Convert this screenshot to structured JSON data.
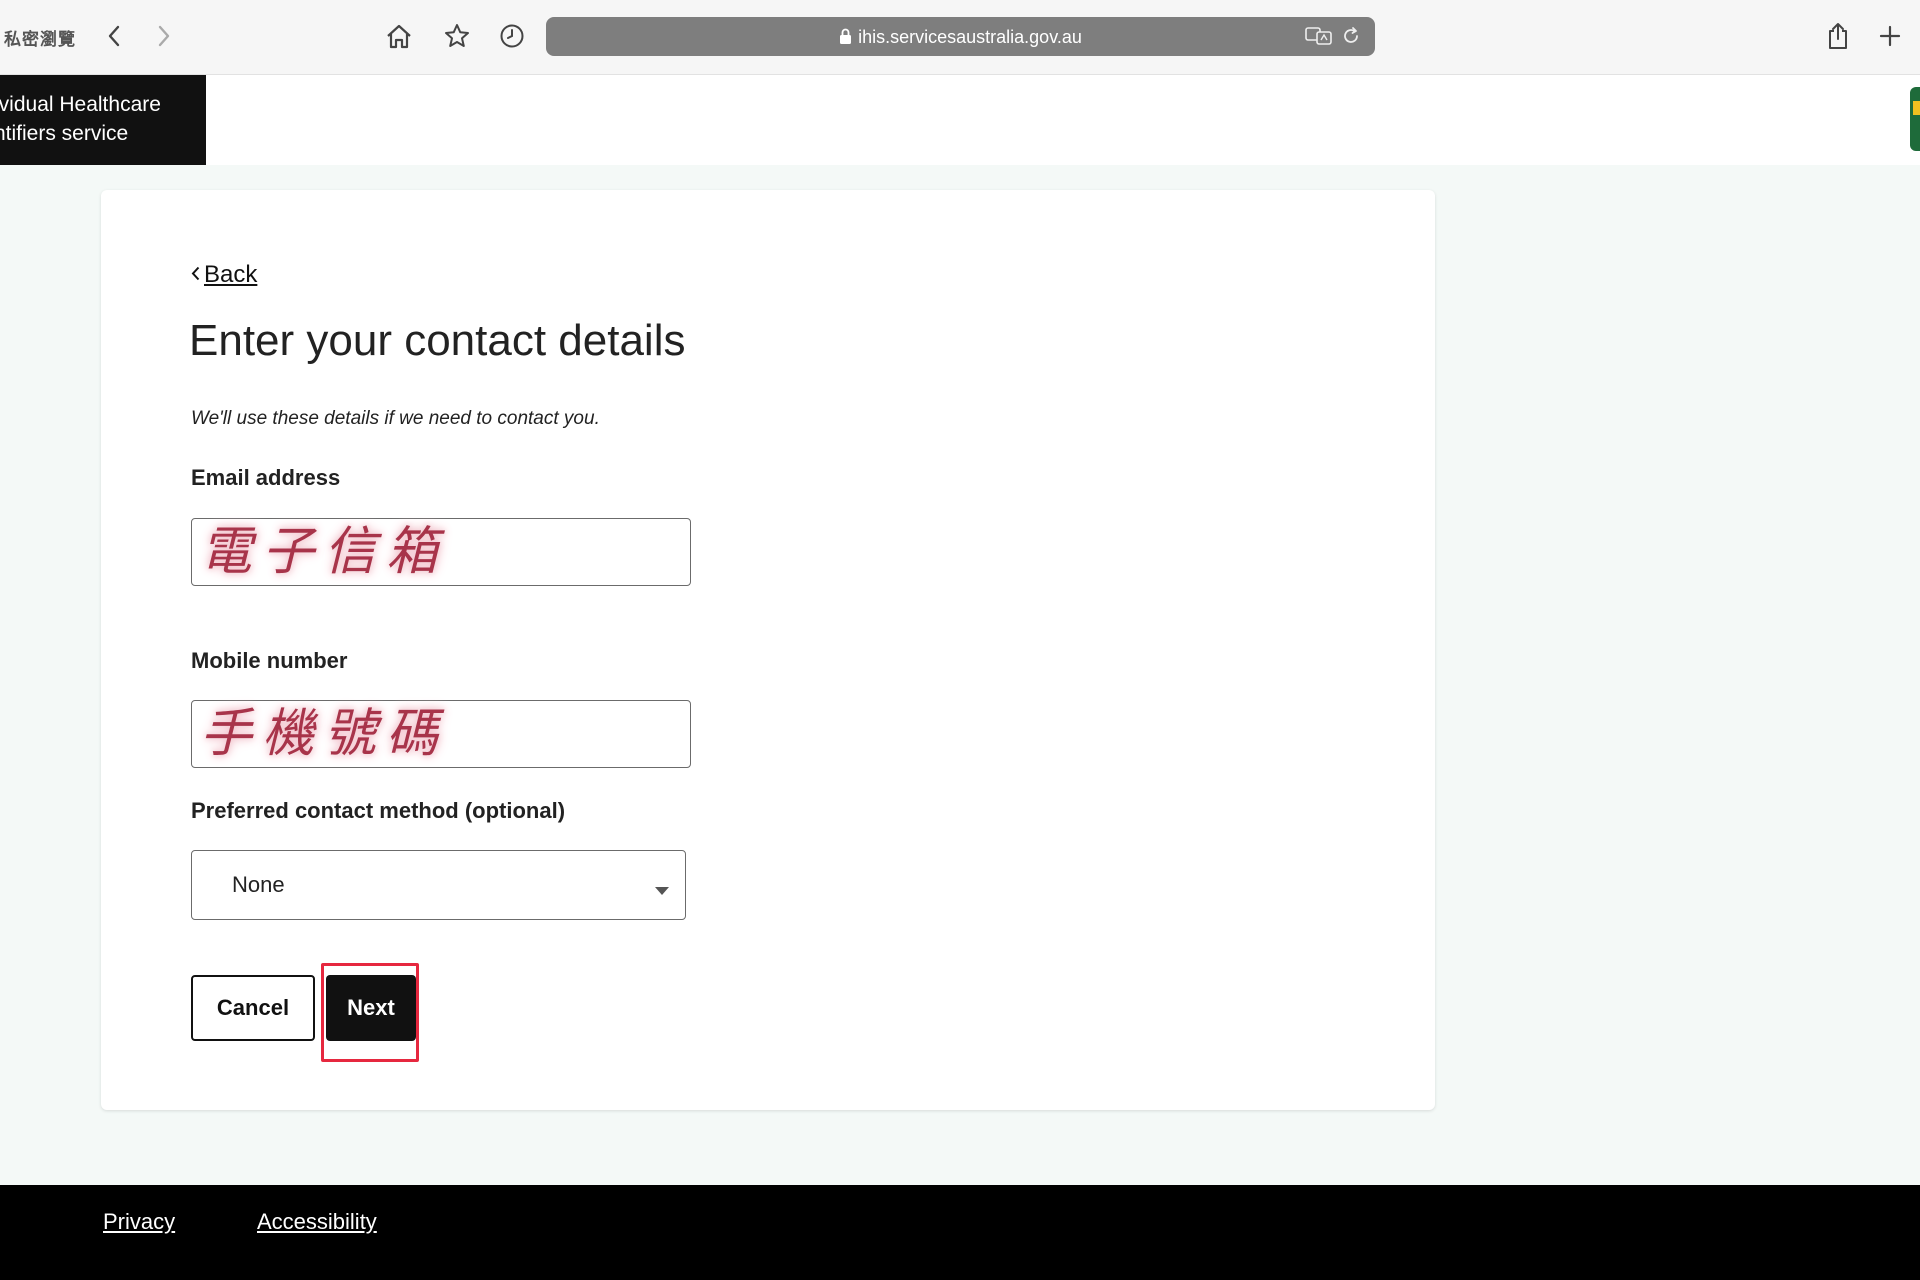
{
  "browser": {
    "private_label": "私密瀏覽",
    "url": "ihis.servicesaustralia.gov.au"
  },
  "header": {
    "brand_line1": "ividual Healthcare",
    "brand_line2": "ntifiers service"
  },
  "form": {
    "back_label": "Back",
    "title": "Enter your contact details",
    "intro": "We'll use these details if we need to contact you.",
    "email_label": "Email address",
    "email_value": "電子信箱",
    "mobile_label": "Mobile number",
    "mobile_value": "手機號碼",
    "contact_method_label": "Preferred contact method (optional)",
    "contact_method_value": "None",
    "cancel_label": "Cancel",
    "next_label": "Next"
  },
  "footer": {
    "privacy_label": "Privacy",
    "accessibility_label": "Accessibility"
  },
  "colors": {
    "highlight": "#e6283f",
    "annotation_ink": "#a8344a",
    "brand_black": "#111111",
    "page_background": "#f4f9f7"
  }
}
